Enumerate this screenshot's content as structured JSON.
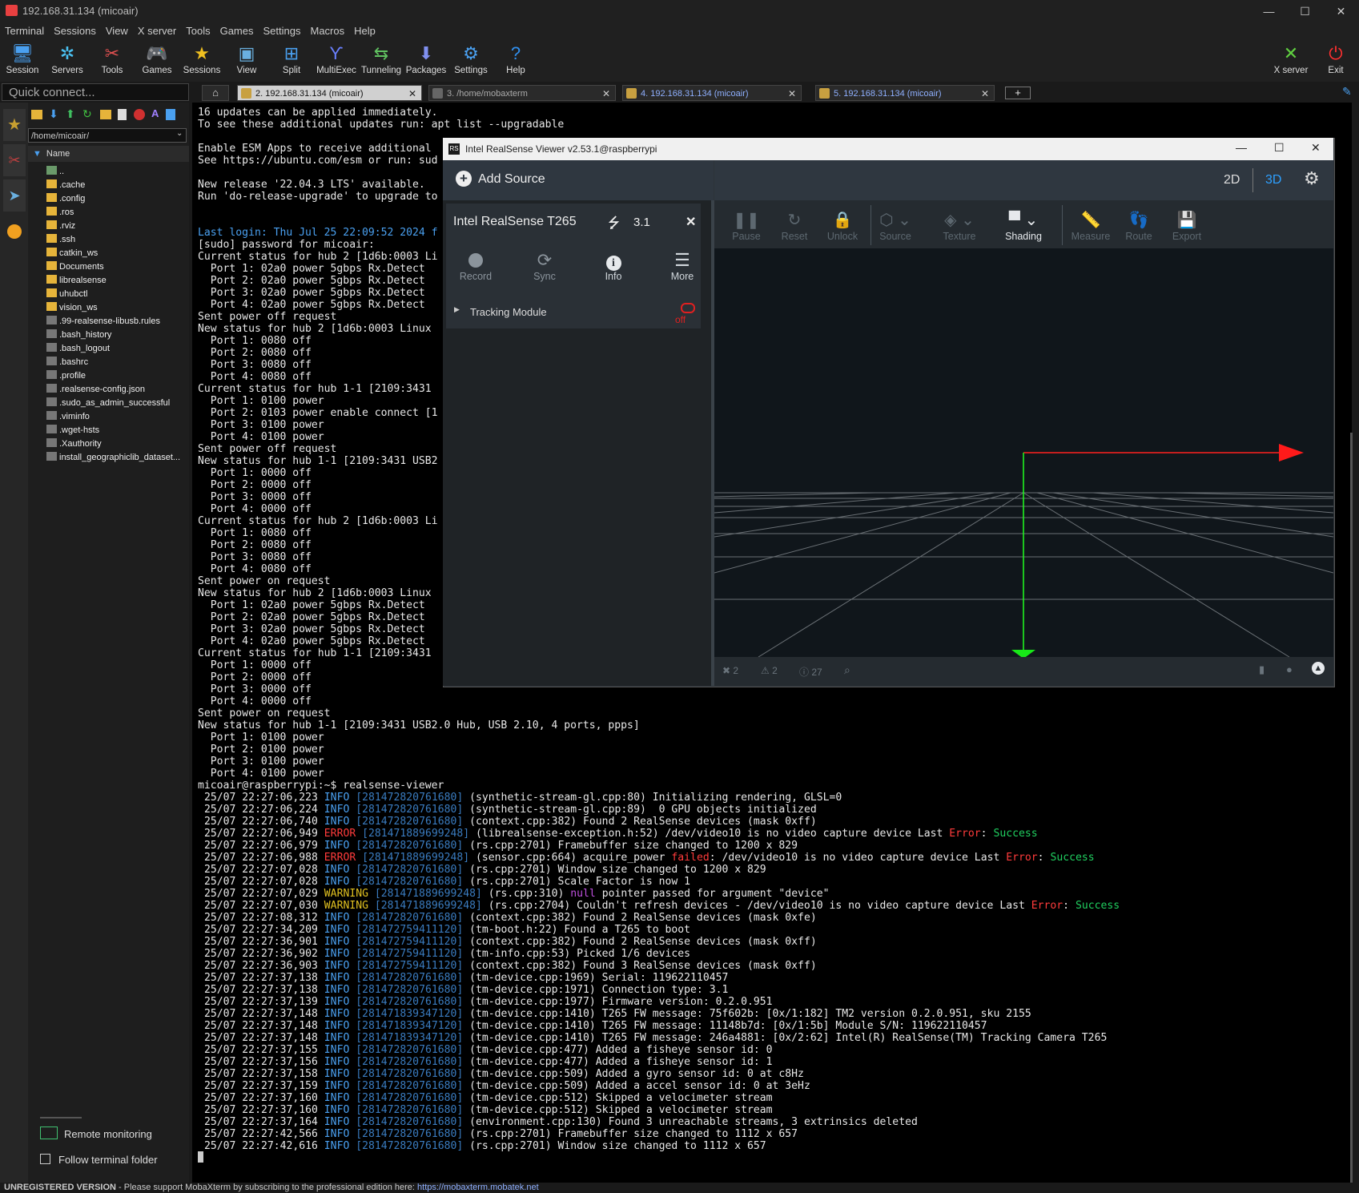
{
  "window": {
    "title": "192.168.31.134 (micoair)"
  },
  "menu": [
    "Terminal",
    "Sessions",
    "View",
    "X server",
    "Tools",
    "Games",
    "Settings",
    "Macros",
    "Help"
  ],
  "toolbar": {
    "left": [
      {
        "label": "Session",
        "icon": "session-icon"
      },
      {
        "label": "Servers",
        "icon": "servers-icon"
      },
      {
        "label": "Tools",
        "icon": "tools-icon"
      },
      {
        "label": "Games",
        "icon": "games-icon"
      },
      {
        "label": "Sessions",
        "icon": "sessions-star-icon"
      },
      {
        "label": "View",
        "icon": "view-icon"
      },
      {
        "label": "Split",
        "icon": "split-icon"
      },
      {
        "label": "MultiExec",
        "icon": "multiexec-icon"
      },
      {
        "label": "Tunneling",
        "icon": "tunneling-icon"
      },
      {
        "label": "Packages",
        "icon": "packages-icon"
      },
      {
        "label": "Settings",
        "icon": "settings-icon"
      },
      {
        "label": "Help",
        "icon": "help-icon"
      }
    ],
    "right": [
      {
        "label": "X server",
        "icon": "xserver-icon"
      },
      {
        "label": "Exit",
        "icon": "power-icon"
      }
    ]
  },
  "quick_connect": {
    "placeholder": "Quick connect..."
  },
  "tabs": [
    {
      "label": "2. 192.168.31.134 (micoair)"
    },
    {
      "label": "3. /home/mobaxterm"
    },
    {
      "label": "4. 192.168.31.134 (micoair)"
    },
    {
      "label": "5. 192.168.31.134 (micoair)"
    }
  ],
  "sidebar": {
    "path": "/home/micoair/",
    "column": "Name",
    "files": [
      {
        "name": "..",
        "type": "up"
      },
      {
        "name": ".cache",
        "type": "folder"
      },
      {
        "name": ".config",
        "type": "folder"
      },
      {
        "name": ".ros",
        "type": "folder"
      },
      {
        "name": ".rviz",
        "type": "folder"
      },
      {
        "name": ".ssh",
        "type": "folder"
      },
      {
        "name": "catkin_ws",
        "type": "folder"
      },
      {
        "name": "Documents",
        "type": "folder"
      },
      {
        "name": "librealsense",
        "type": "folder"
      },
      {
        "name": "uhubctl",
        "type": "folder"
      },
      {
        "name": "vision_ws",
        "type": "folder"
      },
      {
        "name": ".99-realsense-libusb.rules",
        "type": "file"
      },
      {
        "name": ".bash_history",
        "type": "file"
      },
      {
        "name": ".bash_logout",
        "type": "file"
      },
      {
        "name": ".bashrc",
        "type": "file"
      },
      {
        "name": ".profile",
        "type": "file"
      },
      {
        "name": ".realsense-config.json",
        "type": "file"
      },
      {
        "name": ".sudo_as_admin_successful",
        "type": "file"
      },
      {
        "name": ".viminfo",
        "type": "file"
      },
      {
        "name": ".wget-hsts",
        "type": "file"
      },
      {
        "name": ".Xauthority",
        "type": "file"
      },
      {
        "name": "install_geographiclib_dataset...",
        "type": "file"
      }
    ],
    "remote_monitoring": "Remote monitoring",
    "follow_terminal": "Follow terminal folder"
  },
  "terminal": {
    "lines_top": [
      "16 updates can be applied immediately.",
      "To see these additional updates run: apt list --upgradable",
      "",
      "Enable ESM Apps to receive additional",
      "See https://ubuntu.com/esm or run: sud",
      "",
      "New release '22.04.3 LTS' available.",
      "Run 'do-release-upgrade' to upgrade to",
      "",
      "",
      "Last login: Thu Jul 25 22:09:52 2024 f",
      "[sudo] password for micoair:",
      "Current status for hub 2 [1d6b:0003 Li",
      "  Port 1: 02a0 power 5gbps Rx.Detect",
      "  Port 2: 02a0 power 5gbps Rx.Detect",
      "  Port 3: 02a0 power 5gbps Rx.Detect",
      "  Port 4: 02a0 power 5gbps Rx.Detect",
      "Sent power off request",
      "New status for hub 2 [1d6b:0003 Linux",
      "  Port 1: 0080 off",
      "  Port 2: 0080 off",
      "  Port 3: 0080 off",
      "  Port 4: 0080 off",
      "Current status for hub 1-1 [2109:3431",
      "  Port 1: 0100 power",
      "  Port 2: 0103 power enable connect [1",
      "  Port 3: 0100 power",
      "  Port 4: 0100 power",
      "Sent power off request",
      "New status for hub 1-1 [2109:3431 USB2",
      "  Port 1: 0000 off",
      "  Port 2: 0000 off",
      "  Port 3: 0000 off",
      "  Port 4: 0000 off",
      "Current status for hub 2 [1d6b:0003 Li",
      "  Port 1: 0080 off",
      "  Port 2: 0080 off",
      "  Port 3: 0080 off",
      "  Port 4: 0080 off",
      "Sent power on request",
      "New status for hub 2 [1d6b:0003 Linux",
      "  Port 1: 02a0 power 5gbps Rx.Detect",
      "  Port 2: 02a0 power 5gbps Rx.Detect",
      "  Port 3: 02a0 power 5gbps Rx.Detect",
      "  Port 4: 02a0 power 5gbps Rx.Detect",
      "Current status for hub 1-1 [2109:3431",
      "  Port 1: 0000 off",
      "  Port 2: 0000 off",
      "  Port 3: 0000 off",
      "  Port 4: 0000 off",
      "Sent power on request",
      "New status for hub 1-1 [2109:3431 USB2.0 Hub, USB 2.10, 4 ports, ppps]",
      "  Port 1: 0100 power",
      "  Port 2: 0100 power",
      "  Port 3: 0100 power",
      "  Port 4: 0100 power",
      "micoair@raspberrypi:~$ realsense-viewer"
    ],
    "log": [
      {
        "ts": "25/07 22:27:06,223",
        "lvl": "INFO",
        "tid": "[281472820761680]",
        "msg": "(synthetic-stream-gl.cpp:80) Initializing rendering, GLSL=0"
      },
      {
        "ts": "25/07 22:27:06,224",
        "lvl": "INFO",
        "tid": "[281472820761680]",
        "msg": "(synthetic-stream-gl.cpp:89)  0 GPU objects initialized"
      },
      {
        "ts": "25/07 22:27:06,740",
        "lvl": "INFO",
        "tid": "[281472820761680]",
        "msg": "(context.cpp:382) Found 2 RealSense devices (mask 0xff)"
      },
      {
        "ts": "25/07 22:27:06,949",
        "lvl": "ERROR",
        "tid": "[281471889699248]",
        "msg": "(librealsense-exception.h:52) /dev/video10 is no video capture device Last ",
        "e": "Error",
        "s": "Success"
      },
      {
        "ts": "25/07 22:27:06,979",
        "lvl": "INFO",
        "tid": "[281472820761680]",
        "msg": "(rs.cpp:2701) Framebuffer size changed to 1200 x 829"
      },
      {
        "ts": "25/07 22:27:06,988",
        "lvl": "ERROR",
        "tid": "[281471889699248]",
        "msg": "(sensor.cpp:664) acquire_power ",
        "f": "failed",
        "msg2": ": /dev/video10 is no video capture device Last ",
        "e": "Error",
        "s": "Success"
      },
      {
        "ts": "25/07 22:27:07,028",
        "lvl": "INFO",
        "tid": "[281472820761680]",
        "msg": "(rs.cpp:2701) Window size changed to 1200 x 829"
      },
      {
        "ts": "25/07 22:27:07,028",
        "lvl": "INFO",
        "tid": "[281472820761680]",
        "msg": "(rs.cpp:2701) Scale Factor is now 1"
      },
      {
        "ts": "25/07 22:27:07,029",
        "lvl": "WARNING",
        "tid": "[281471889699248]",
        "msg": "(rs.cpp:310) ",
        "n": "null",
        "msg2": " pointer passed for argument \"device\""
      },
      {
        "ts": "25/07 22:27:07,030",
        "lvl": "WARNING",
        "tid": "[281471889699248]",
        "msg": "(rs.cpp:2704) Couldn't refresh devices - /dev/video10 is no video capture device Last ",
        "e": "Error",
        "s": "Success"
      },
      {
        "ts": "25/07 22:27:08,312",
        "lvl": "INFO",
        "tid": "[281472820761680]",
        "msg": "(context.cpp:382) Found 2 RealSense devices (mask 0xfe)"
      },
      {
        "ts": "25/07 22:27:34,209",
        "lvl": "INFO",
        "tid": "[281472759411120]",
        "msg": "(tm-boot.h:22) Found a T265 to boot"
      },
      {
        "ts": "25/07 22:27:36,901",
        "lvl": "INFO",
        "tid": "[281472759411120]",
        "msg": "(context.cpp:382) Found 2 RealSense devices (mask 0xff)"
      },
      {
        "ts": "25/07 22:27:36,902",
        "lvl": "INFO",
        "tid": "[281472759411120]",
        "msg": "(tm-info.cpp:53) Picked 1/6 devices"
      },
      {
        "ts": "25/07 22:27:36,903",
        "lvl": "INFO",
        "tid": "[281472759411120]",
        "msg": "(context.cpp:382) Found 3 RealSense devices (mask 0xff)"
      },
      {
        "ts": "25/07 22:27:37,138",
        "lvl": "INFO",
        "tid": "[281472820761680]",
        "msg": "(tm-device.cpp:1969) Serial: 119622110457"
      },
      {
        "ts": "25/07 22:27:37,138",
        "lvl": "INFO",
        "tid": "[281472820761680]",
        "msg": "(tm-device.cpp:1971) Connection type: 3.1"
      },
      {
        "ts": "25/07 22:27:37,139",
        "lvl": "INFO",
        "tid": "[281472820761680]",
        "msg": "(tm-device.cpp:1977) Firmware version: 0.2.0.951"
      },
      {
        "ts": "25/07 22:27:37,148",
        "lvl": "INFO",
        "tid": "[281471839347120]",
        "msg": "(tm-device.cpp:1410) T265 FW message: 75f602b: [0x/1:182] TM2 version 0.2.0.951, sku 2155"
      },
      {
        "ts": "25/07 22:27:37,148",
        "lvl": "INFO",
        "tid": "[281471839347120]",
        "msg": "(tm-device.cpp:1410) T265 FW message: 11148b7d: [0x/1:5b] Module S/N: 119622110457"
      },
      {
        "ts": "25/07 22:27:37,148",
        "lvl": "INFO",
        "tid": "[281471839347120]",
        "msg": "(tm-device.cpp:1410) T265 FW message: 246a4881: [0x/2:62] Intel(R) RealSense(TM) Tracking Camera T265"
      },
      {
        "ts": "25/07 22:27:37,155",
        "lvl": "INFO",
        "tid": "[281472820761680]",
        "msg": "(tm-device.cpp:477) Added a fisheye sensor id: 0"
      },
      {
        "ts": "25/07 22:27:37,156",
        "lvl": "INFO",
        "tid": "[281472820761680]",
        "msg": "(tm-device.cpp:477) Added a fisheye sensor id: 1"
      },
      {
        "ts": "25/07 22:27:37,158",
        "lvl": "INFO",
        "tid": "[281472820761680]",
        "msg": "(tm-device.cpp:509) Added a gyro sensor id: 0 at c8Hz"
      },
      {
        "ts": "25/07 22:27:37,159",
        "lvl": "INFO",
        "tid": "[281472820761680]",
        "msg": "(tm-device.cpp:509) Added a accel sensor id: 0 at 3eHz"
      },
      {
        "ts": "25/07 22:27:37,160",
        "lvl": "INFO",
        "tid": "[281472820761680]",
        "msg": "(tm-device.cpp:512) Skipped a velocimeter stream"
      },
      {
        "ts": "25/07 22:27:37,160",
        "lvl": "INFO",
        "tid": "[281472820761680]",
        "msg": "(tm-device.cpp:512) Skipped a velocimeter stream"
      },
      {
        "ts": "25/07 22:27:37,164",
        "lvl": "INFO",
        "tid": "[281472820761680]",
        "msg": "(environment.cpp:130) Found 3 unreachable streams, 3 extrinsics deleted"
      },
      {
        "ts": "25/07 22:27:42,566",
        "lvl": "INFO",
        "tid": "[281472820761680]",
        "msg": "(rs.cpp:2701) Framebuffer size changed to 1112 x 657"
      },
      {
        "ts": "25/07 22:27:42,616",
        "lvl": "INFO",
        "tid": "[281472820761680]",
        "msg": "(rs.cpp:2701) Window size changed to 1112 x 657"
      }
    ]
  },
  "status_bar": {
    "unregistered": "UNREGISTERED VERSION",
    "message": "  -  Please support MobaXterm by subscribing to the professional edition here:",
    "link": "https://mobaxterm.mobatek.net"
  },
  "realsense": {
    "title": "Intel RealSense Viewer v2.53.1@raspberrypi",
    "add_source": "Add Source",
    "view_2d": "2D",
    "view_3d": "3D",
    "device_name": "Intel RealSense T265",
    "usb_version": "3.1",
    "device_actions": [
      "Record",
      "Sync",
      "Info",
      "More"
    ],
    "module": "Tracking Module",
    "module_state": "off",
    "tools": [
      "Pause",
      "Reset",
      "Unlock",
      "Source",
      "Texture",
      "Shading",
      "Measure",
      "Route",
      "Export"
    ],
    "bottom_counts": {
      "errors": "2",
      "warnings": "2",
      "info": "27"
    }
  }
}
